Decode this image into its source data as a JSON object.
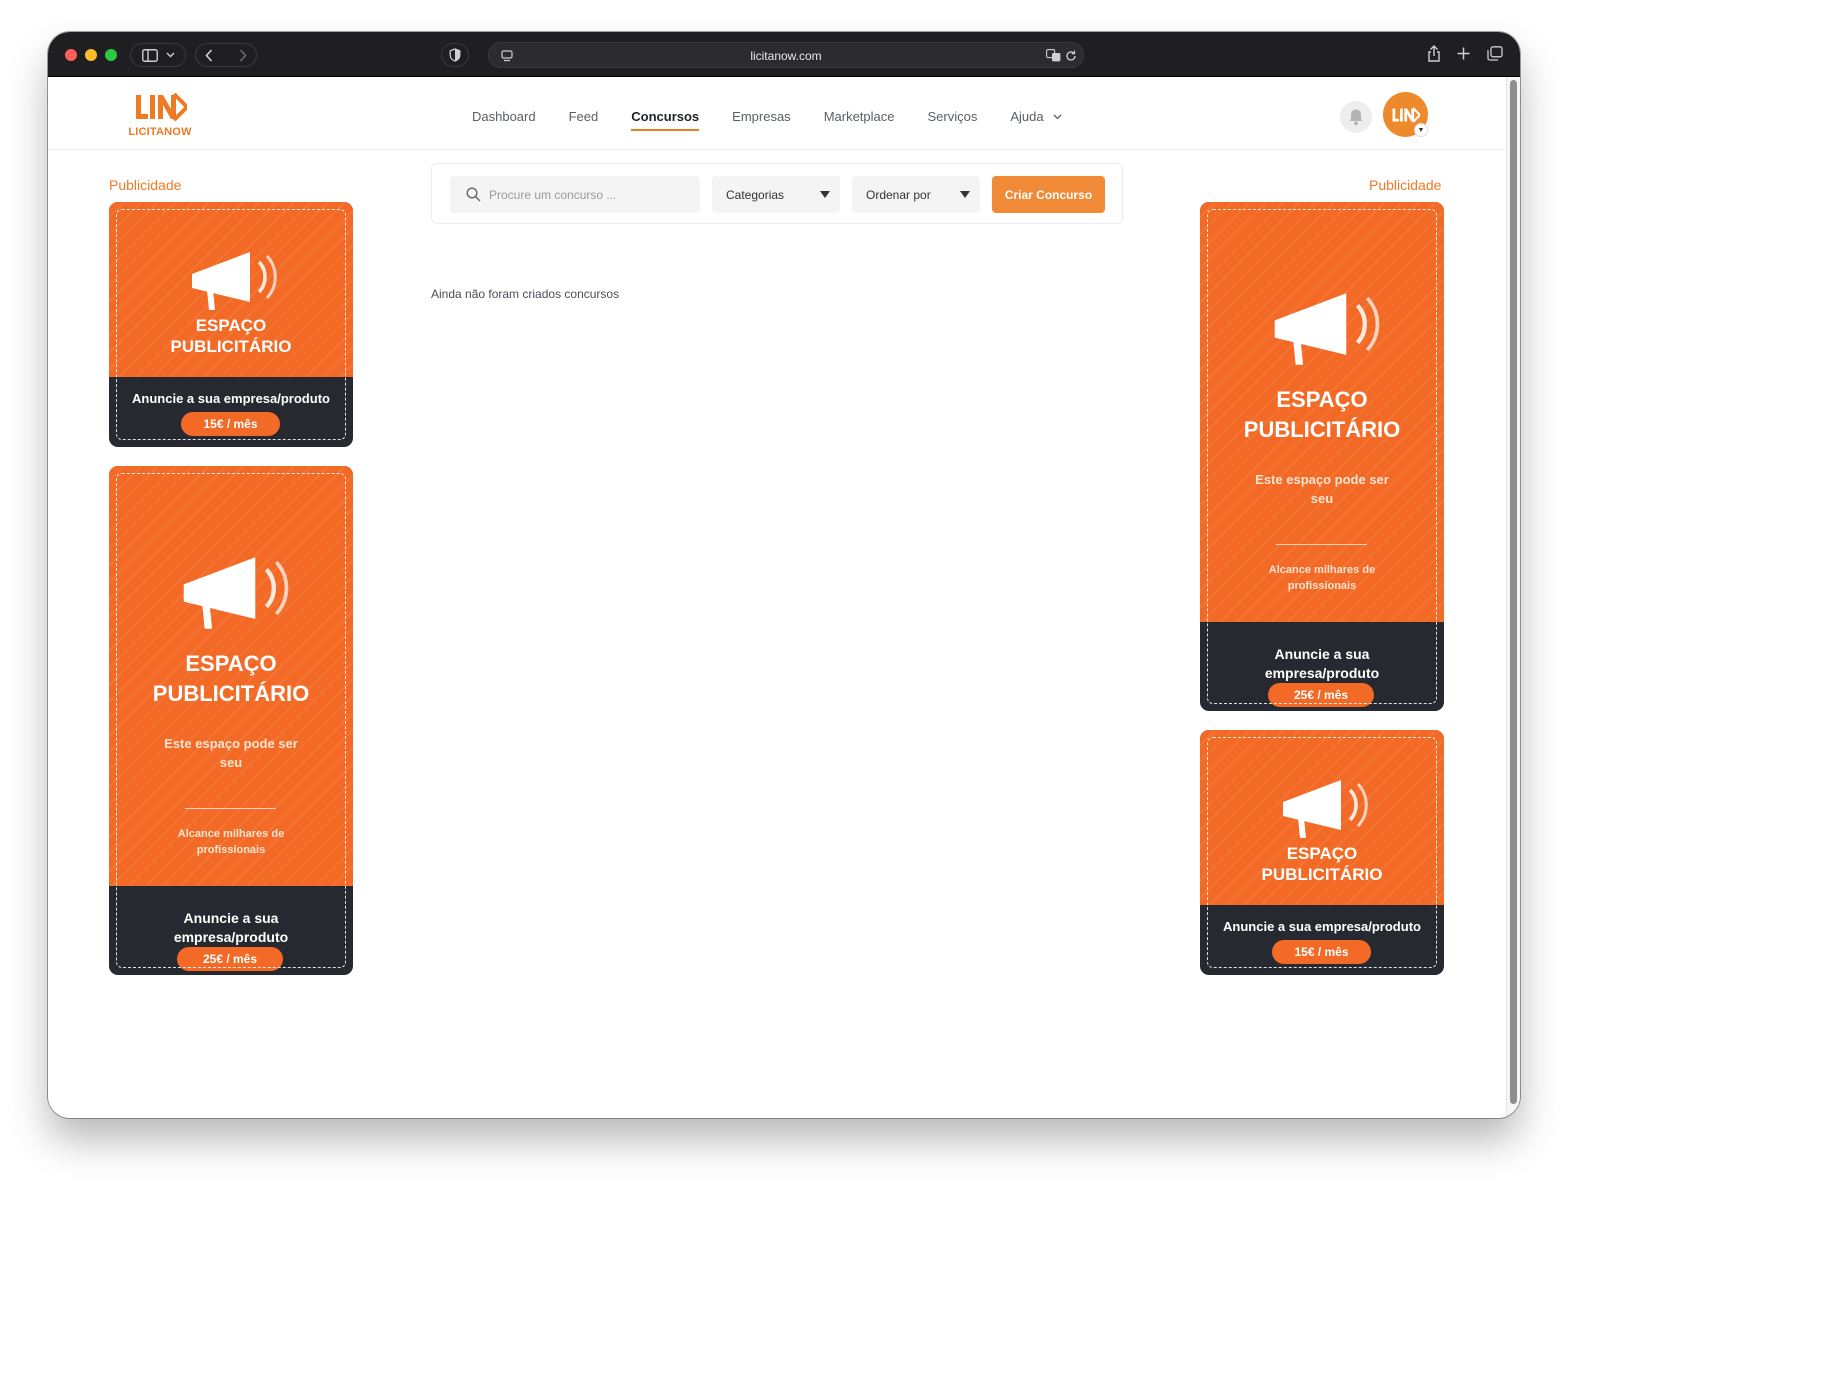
{
  "browser": {
    "url": "licitanow.com"
  },
  "header": {
    "logo_text": "LICITANOW",
    "nav": [
      {
        "label": "Dashboard"
      },
      {
        "label": "Feed"
      },
      {
        "label": "Concursos",
        "active": true
      },
      {
        "label": "Empresas"
      },
      {
        "label": "Marketplace"
      },
      {
        "label": "Serviços"
      },
      {
        "label": "Ajuda"
      }
    ]
  },
  "ads": {
    "label": "Publicidade",
    "title_line1": "ESPAÇO",
    "title_line2": "PUBLICITÁRIO",
    "sub_line1": "Este espaço pode ser",
    "sub_line2": "seu",
    "reach_line1": "Alcance milhares de",
    "reach_line2": "profissionais",
    "cta_single": "Anuncie a sua empresa/produto",
    "cta_line1": "Anuncie a sua",
    "cta_line2": "empresa/produto",
    "price_small": "15€ / mês",
    "price_large": "25€ / mês"
  },
  "filters": {
    "search_placeholder": "Procure um concurso ...",
    "categories": "Categorias",
    "order_by": "Ordenar por",
    "create_button": "Criar Concurso"
  },
  "empty_state": "Ainda não foram criados concursos",
  "colors": {
    "accent": "#ee7a23",
    "ad_orange": "#f26a26",
    "ad_dark": "#262a30"
  }
}
